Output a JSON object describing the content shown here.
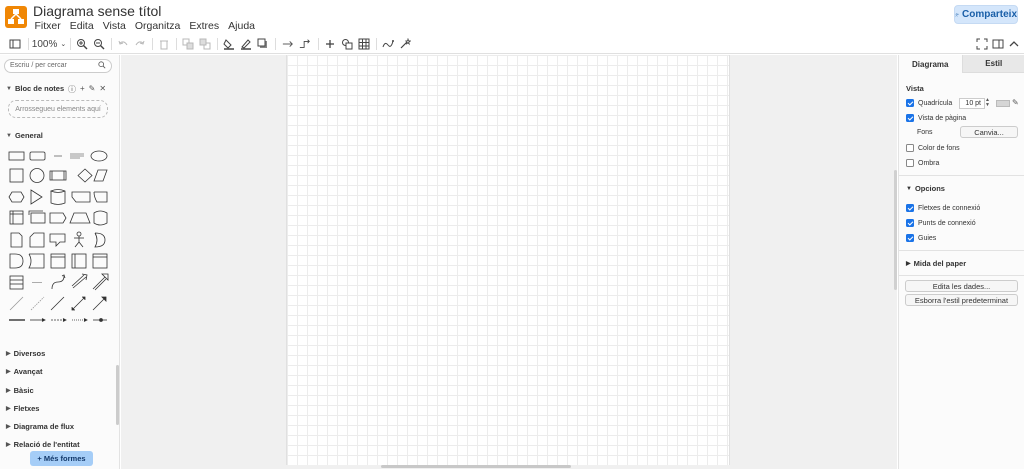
{
  "header": {
    "title": "Diagrama sense títol",
    "menu": [
      "Fitxer",
      "Edita",
      "Vista",
      "Organitza",
      "Extres",
      "Ajuda"
    ],
    "share_label": "Comparteix"
  },
  "toolbar": {
    "zoom": "100%"
  },
  "left_panel": {
    "search_placeholder": "Escriu / per cercar",
    "scratchpad_title": "Bloc de notes",
    "drop_text": "Arrossegueu elements aquí",
    "general_title": "General",
    "libraries": [
      "Diversos",
      "Avançat",
      "Bàsic",
      "Fletxes",
      "Diagrama de flux",
      "Relació de l'entitat"
    ],
    "more_shapes": "+ Més formes"
  },
  "right_panel": {
    "tabs": [
      "Diagrama",
      "Estil"
    ],
    "view_title": "Vista",
    "grid_label": "Quadrícula",
    "grid_size": "10 pt",
    "page_view_label": "Vista de pàgina",
    "background_label": "Fons",
    "change_button": "Canvia...",
    "bg_color_label": "Color de fons",
    "shadow_label": "Ombra",
    "options_title": "Opcions",
    "connection_arrows": "Fletxes de connexió",
    "connection_points": "Punts de connexió",
    "guides": "Guies",
    "paper_size_title": "Mida del paper",
    "edit_data_button": "Edita les dades...",
    "reset_style_button": "Esborra l'estil predeterminat"
  }
}
